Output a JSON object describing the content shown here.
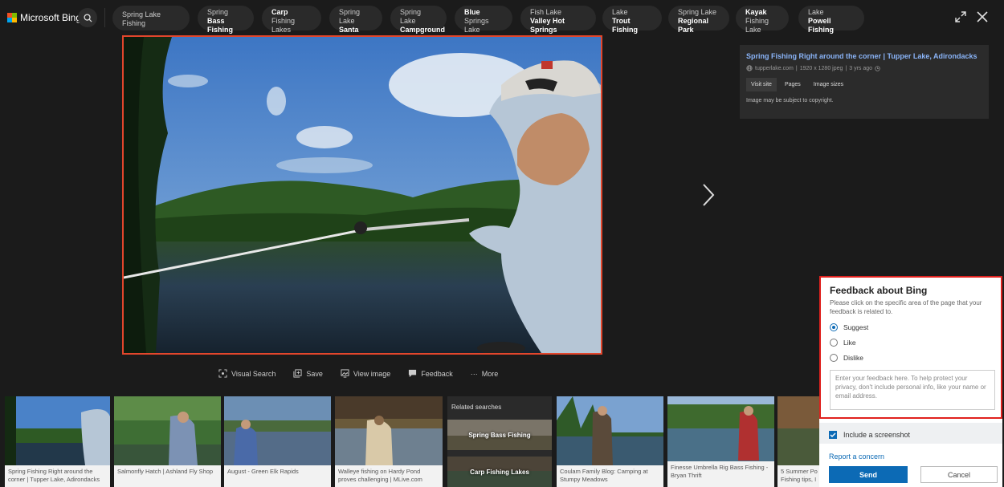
{
  "brand": {
    "name": "Microsoft Bing"
  },
  "related_chips": [
    {
      "line1": "Spring Lake Fishing",
      "line2": "",
      "bold": "none"
    },
    {
      "line1": "Spring",
      "line2": "Bass Fishing",
      "bold": "line2"
    },
    {
      "line1": "Carp",
      "line2": "Fishing Lakes",
      "bold": "line1"
    },
    {
      "line1": "Spring Lake",
      "line2": "Santa Rosa",
      "bold": "line2"
    },
    {
      "line1": "Spring Lake",
      "line2": "Campground",
      "bold": "line2"
    },
    {
      "line1": "Blue",
      "line2": "Springs Lake",
      "bold": "line1"
    },
    {
      "line1": "Fish Lake",
      "line2": "Valley Hot Springs",
      "bold": "line2"
    },
    {
      "line1": "Lake",
      "line2": "Trout Fishing",
      "bold": "line2"
    },
    {
      "line1": "Spring Lake",
      "line2": "Regional Park",
      "bold": "line2"
    },
    {
      "line1": "Kayak",
      "line2": "Fishing Lake",
      "bold": "line1"
    },
    {
      "line1": "Lake",
      "line2": "Powell Fishing",
      "bold": "line2"
    }
  ],
  "info": {
    "title": "Spring Fishing Right around the corner | Tupper Lake, Adirondacks",
    "domain": "tupperlake.com",
    "dimensions": "1920 x 1280 jpeg",
    "age": "3 yrs ago",
    "visit_site": "Visit site",
    "pages": "Pages",
    "image_sizes": "Image sizes",
    "copyright": "Image may be subject to copyright."
  },
  "toolbar": {
    "visual_search": "Visual Search",
    "save": "Save",
    "view_image": "View image",
    "feedback": "Feedback",
    "more": "More"
  },
  "thumbnails": [
    {
      "caption": "Spring Fishing Right around the corner | Tupper Lake, Adirondacks"
    },
    {
      "caption": "Salmonfly Hatch | Ashland Fly Shop"
    },
    {
      "caption": "August - Green Elk Rapids"
    },
    {
      "caption": "Walleye fishing on Hardy Pond proves challenging | MLive.com"
    },
    {
      "caption": "Coulam Family Blog: Camping at Stumpy Meadows"
    },
    {
      "caption": "Finesse Umbrella Rig Bass Fishing - Bryan Thrift"
    },
    {
      "caption": "5 Summer Po Fishing tips, I"
    }
  ],
  "related_searches": {
    "title": "Related searches",
    "items": [
      "Spring Bass Fishing",
      "Carp Fishing Lakes"
    ]
  },
  "feedback": {
    "title": "Feedback about Bing",
    "description": "Please click on the specific area of the page that your feedback is related to.",
    "options": [
      "Suggest",
      "Like",
      "Dislike"
    ],
    "selected": "Suggest",
    "placeholder": "Enter your feedback here. To help protect your privacy, don't include personal info, like your name or email address.",
    "include_screenshot": "Include a screenshot",
    "report": "Report a concern",
    "send": "Send",
    "cancel": "Cancel"
  }
}
